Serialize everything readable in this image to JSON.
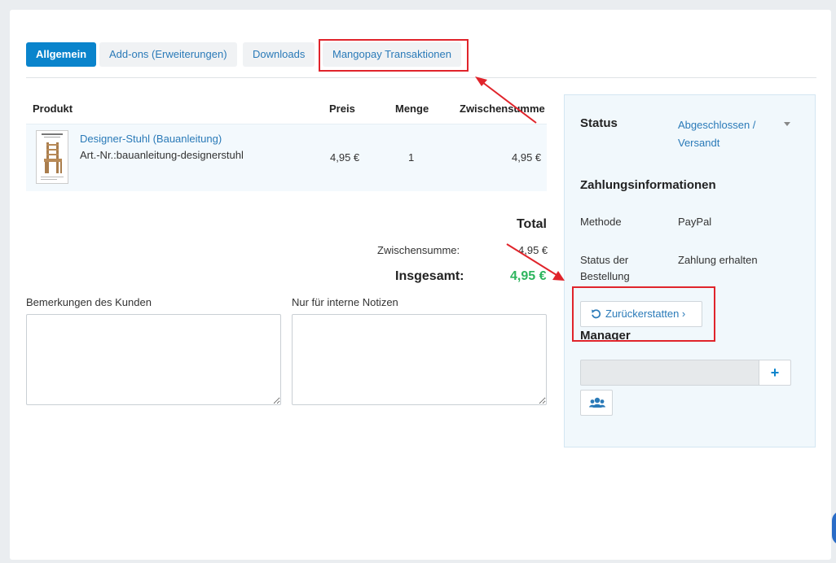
{
  "tabs": [
    {
      "label": "Allgemein",
      "active": true
    },
    {
      "label": "Add-ons (Erweiterungen)",
      "active": false
    },
    {
      "label": "Downloads",
      "active": false
    },
    {
      "label": "Mangopay Transaktionen",
      "active": false
    }
  ],
  "table": {
    "headers": {
      "product": "Produkt",
      "price": "Preis",
      "qty": "Menge",
      "subtotal": "Zwischensumme"
    },
    "rows": [
      {
        "product_name": "Designer-Stuhl (Bauanleitung)",
        "sku": "Art.-Nr.:bauanleitung-designerstuhl",
        "price": "4,95 €",
        "qty": "1",
        "subtotal": "4,95 €"
      }
    ]
  },
  "totals": {
    "title": "Total",
    "subtotal_label": "Zwischensumme:",
    "subtotal_value": "4,95 €",
    "grand_label": "Insgesamt:",
    "grand_value": "4,95 €"
  },
  "notes": {
    "customer_label": "Bemerkungen des Kunden",
    "internal_label": "Nur für interne Notizen"
  },
  "sidebar": {
    "status_label": "Status",
    "status_value_line1": "Abgeschlossen /",
    "status_value_line2": "Versandt",
    "payment_heading": "Zahlungsinformationen",
    "method_label": "Methode",
    "method_value": "PayPal",
    "order_status_label_line1": "Status der",
    "order_status_label_line2": "Bestellung",
    "order_status_value": "Zahlung erhalten",
    "refund_button": "Zurückerstatten ›",
    "manager_heading": "Manager",
    "add_button": "+"
  },
  "colors": {
    "accent": "#0a84cc",
    "link": "#2a7ab8",
    "total_green": "#2db55d",
    "highlight_red": "#e0242b"
  },
  "icons": [
    "refresh-icon",
    "plus-icon",
    "users-icon",
    "caret-down-icon"
  ]
}
